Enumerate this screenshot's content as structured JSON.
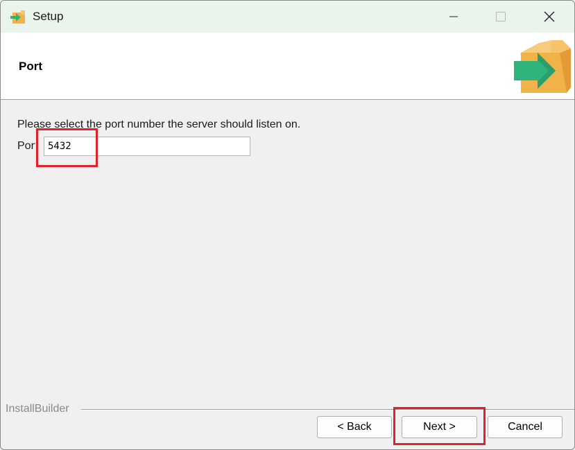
{
  "window": {
    "title": "Setup",
    "icons": {
      "app": "installer-box-icon",
      "minimize": "minimize-icon",
      "maximize": "maximize-icon",
      "close": "close-icon"
    }
  },
  "header": {
    "title": "Port",
    "logo": "installer-box-logo"
  },
  "content": {
    "instruction": "Please select the port number the server should listen on.",
    "port_label": "Port",
    "port_value": "5432"
  },
  "footer": {
    "brand": "InstallBuilder",
    "back_label": "< Back",
    "next_label": "Next >",
    "cancel_label": "Cancel"
  },
  "colors": {
    "highlight": "#e0202a",
    "titlebar": "#e9f4ec",
    "arrow_green": "#2fb37a",
    "box_orange": "#f2b24a"
  }
}
